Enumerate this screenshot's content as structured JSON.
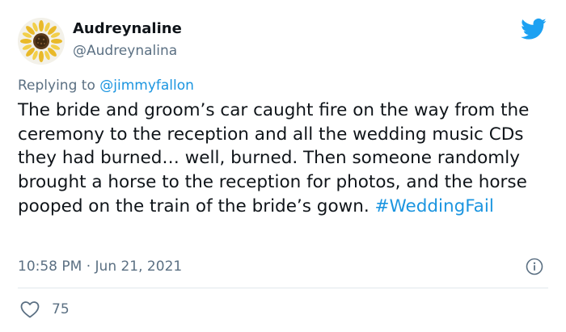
{
  "author": {
    "display_name": "Audreynaline",
    "handle": "@Audreynalina",
    "avatar_icon": "sunflower-avatar"
  },
  "reply": {
    "prefix": "Replying to ",
    "mention": "@jimmyfallon"
  },
  "tweet": {
    "body": "The bride and groom’s car caught fire on the way from the ceremony to the reception and all the wedding music CDs they had burned… well, burned. Then someone randomly brought a horse to the reception for photos, and the horse pooped on the train of the bride’s gown.",
    "hashtag": "#WeddingFail"
  },
  "meta": {
    "timestamp": "10:58 PM · Jun 21, 2021"
  },
  "actions": {
    "like_count": "75"
  },
  "icons": {
    "brand": "twitter-bird-icon",
    "info": "info-icon",
    "like": "heart-icon"
  },
  "colors": {
    "accent": "#1da1f2",
    "link": "#1b95e0",
    "secondary_text": "#5b7083",
    "primary_text": "#0f1419",
    "divider": "#e1e8ed"
  }
}
